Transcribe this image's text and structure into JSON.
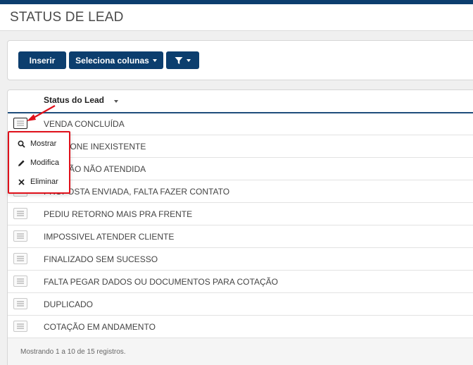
{
  "header": {
    "title": "STATUS DE LEAD"
  },
  "toolbar": {
    "insert_label": "Inserir",
    "columns_label": "Seleciona colunas",
    "filter_icon": "filter-icon"
  },
  "table": {
    "column_header": "Status do Lead",
    "rows": [
      "VENDA CONCLUÍDA",
      "TELEFONE INEXISTENTE",
      "LIGAÇÃO NÃO ATENDIDA",
      "PROPOSTA ENVIADA, FALTA FAZER CONTATO",
      "PEDIU RETORNO MAIS PRA FRENTE",
      "IMPOSSIVEL ATENDER CLIENTE",
      "FINALIZADO SEM SUCESSO",
      "FALTA PEGAR DADOS OU DOCUMENTOS PARA COTAÇÃO",
      "DUPLICADO",
      "COTAÇÃO EM ANDAMENTO"
    ]
  },
  "context_menu": {
    "items": [
      {
        "label": "Mostrar",
        "icon": "search-icon"
      },
      {
        "label": "Modifica",
        "icon": "pencil-icon"
      },
      {
        "label": "Eliminar",
        "icon": "close-icon"
      }
    ]
  },
  "footer": {
    "text": "Mostrando 1 a 10 de 15 registros."
  },
  "colors": {
    "primary": "#0c3e6e",
    "highlight": "#e0101a"
  }
}
